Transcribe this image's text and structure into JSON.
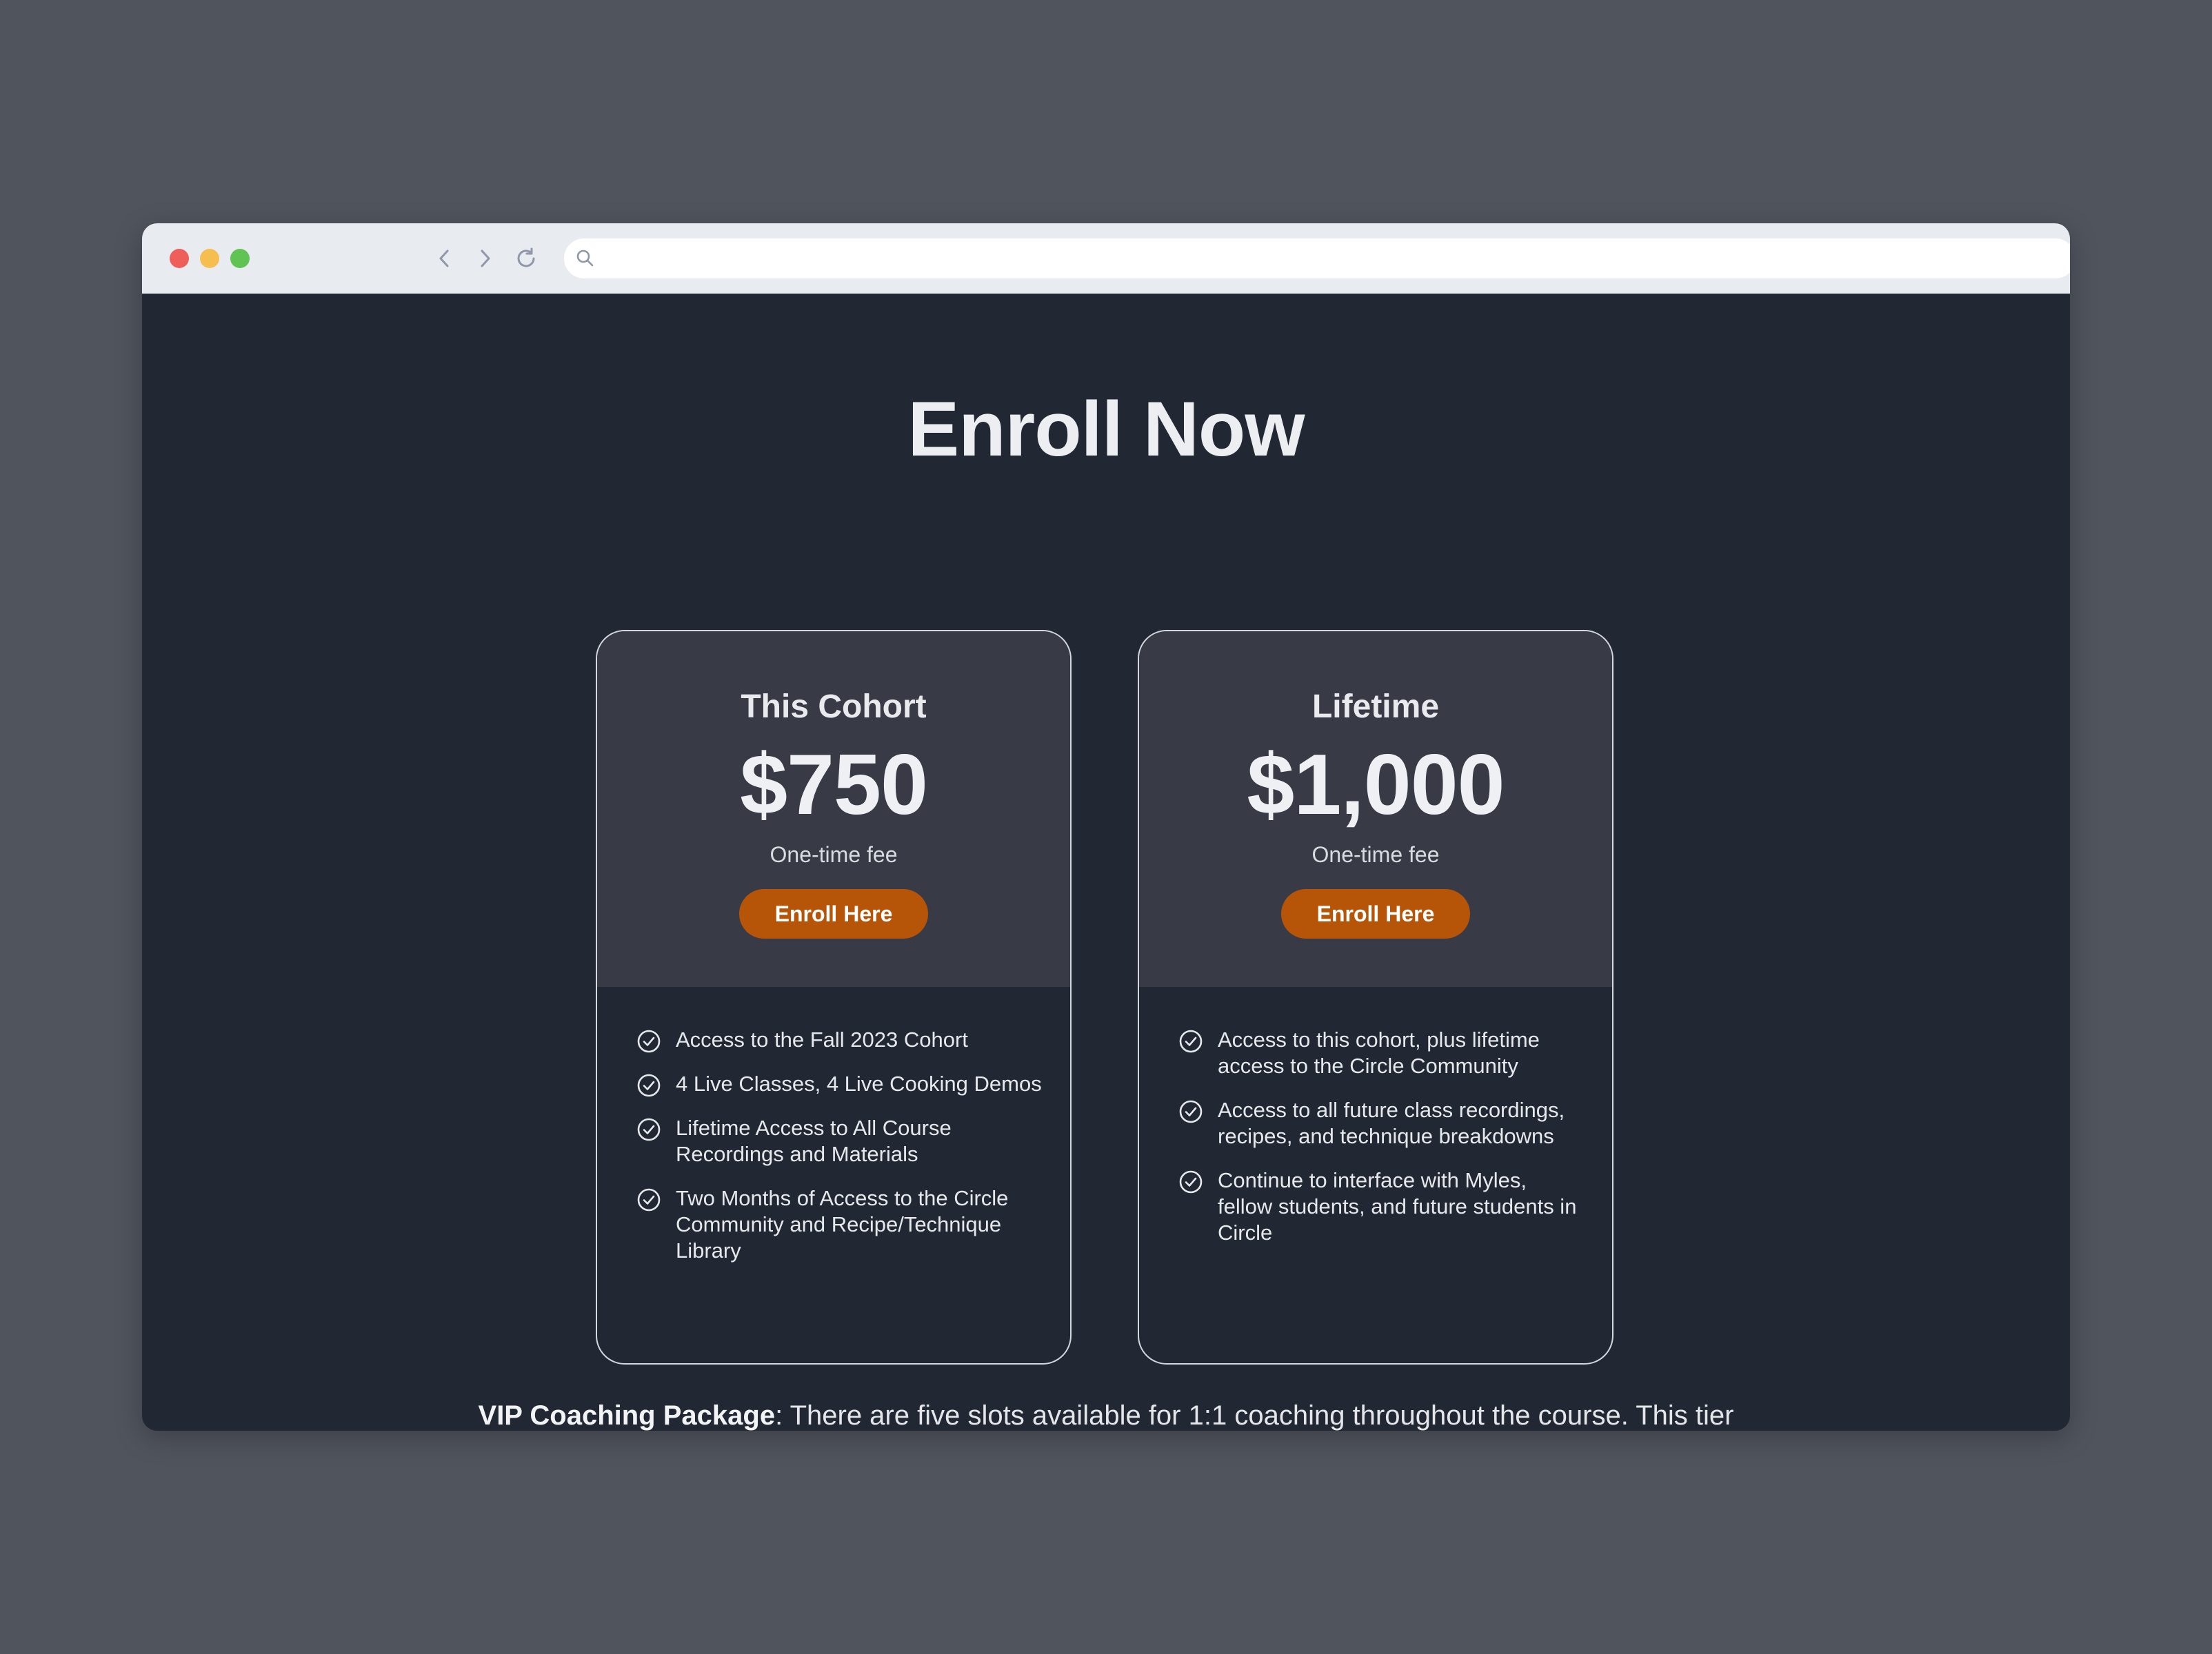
{
  "browser": {
    "url_value": "",
    "icons": [
      "back-icon",
      "forward-icon",
      "reload-icon",
      "search-icon",
      "expand-icon",
      "menu-icon"
    ],
    "traffic_light_colors": [
      "#ee5f5b",
      "#f6be4f",
      "#5fc454"
    ]
  },
  "page": {
    "heading": "Enroll Now",
    "accent_color": "#b65508",
    "cards": [
      {
        "name": "This Cohort",
        "price": "$750",
        "fee_note": "One-time fee",
        "button_label": "Enroll Here",
        "features": [
          "Access to the Fall 2023 Cohort",
          "4 Live Classes, 4 Live Cooking Demos",
          "Lifetime Access to All Course Recordings and Materials",
          "Two Months of Access to the Circle Community and Recipe/Technique Library"
        ]
      },
      {
        "name": "Lifetime",
        "price": "$1,000",
        "fee_note": "One-time fee",
        "button_label": "Enroll Here",
        "features": [
          "Access to this cohort, plus lifetime access to the Circle Community",
          "Access to all future class recordings, recipes, and technique breakdowns",
          "Continue to interface with Myles, fellow students, and future students in Circle"
        ]
      }
    ],
    "vip": {
      "title": "VIP Coaching Package",
      "text": ": There are five slots available for 1:1 coaching throughout the course. This tier"
    }
  }
}
